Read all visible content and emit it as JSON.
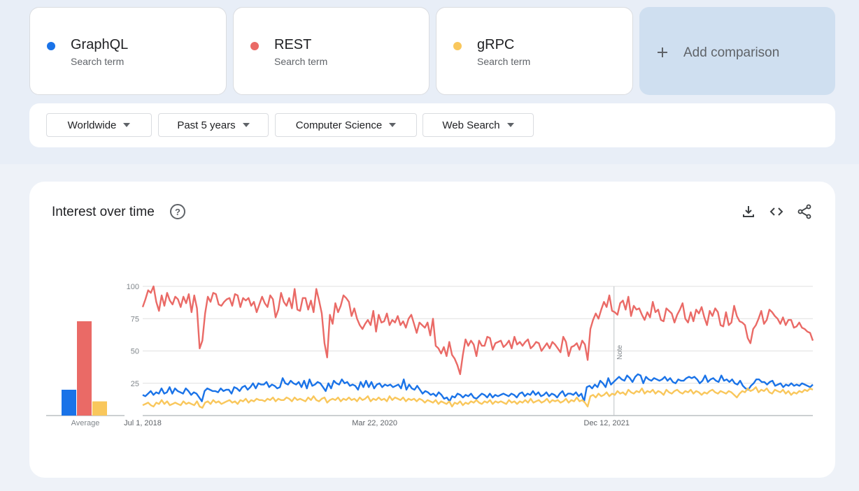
{
  "terms": [
    {
      "name": "GraphQL",
      "subtitle": "Search term",
      "color": "#1a73e8"
    },
    {
      "name": "REST",
      "subtitle": "Search term",
      "color": "#ea6a66"
    },
    {
      "name": "gRPC",
      "subtitle": "Search term",
      "color": "#f9c75c"
    }
  ],
  "add_comparison": {
    "label": "Add comparison",
    "icon": "plus-icon"
  },
  "filters": {
    "region": "Worldwide",
    "time": "Past 5 years",
    "category": "Computer Science",
    "source": "Web Search"
  },
  "chart_card": {
    "title": "Interest over time",
    "help_icon": "help-circle-icon",
    "actions": [
      "download-icon",
      "embed-code-icon",
      "share-icon"
    ]
  },
  "chart_data": [
    {
      "type": "bar",
      "categories": [
        "GraphQL",
        "REST",
        "gRPC"
      ],
      "values": [
        20,
        73,
        11
      ],
      "xlabel": "Average",
      "ylim": [
        0,
        100
      ],
      "colors": [
        "#1a73e8",
        "#ea6a66",
        "#f9c75c"
      ]
    },
    {
      "type": "line",
      "x_start": "2018-07-01",
      "x_end": "2023-06-25",
      "x_ticks": [
        "Jul 1, 2018",
        "Mar 22, 2020",
        "Dec 12, 2021"
      ],
      "y_ticks": [
        25,
        50,
        75,
        100
      ],
      "ylim": [
        0,
        100
      ],
      "grid": true,
      "annotation": {
        "label": "Note",
        "date": "2022-01-01"
      },
      "series": [
        {
          "name": "REST",
          "color": "#ea6a66",
          "values": [
            84,
            90,
            97,
            95,
            100,
            88,
            81,
            93,
            85,
            95,
            89,
            86,
            92,
            90,
            84,
            92,
            87,
            94,
            80,
            93,
            83,
            52,
            58,
            79,
            92,
            88,
            95,
            94,
            86,
            85,
            88,
            90,
            91,
            85,
            94,
            93,
            84,
            91,
            89,
            91,
            85,
            88,
            80,
            86,
            92,
            87,
            84,
            93,
            90,
            76,
            82,
            95,
            88,
            85,
            91,
            83,
            98,
            82,
            81,
            91,
            91,
            82,
            89,
            80,
            98,
            89,
            79,
            56,
            45,
            78,
            71,
            87,
            80,
            85,
            93,
            91,
            88,
            77,
            83,
            75,
            70,
            67,
            71,
            74,
            70,
            81,
            65,
            78,
            72,
            73,
            79,
            70,
            74,
            72,
            77,
            70,
            73,
            68,
            75,
            78,
            71,
            64,
            72,
            70,
            68,
            72,
            62,
            75,
            54,
            52,
            48,
            53,
            46,
            57,
            47,
            44,
            39,
            32,
            47,
            59,
            54,
            58,
            55,
            46,
            58,
            54,
            54,
            61,
            60,
            51,
            56,
            57,
            58,
            53,
            55,
            58,
            52,
            61,
            55,
            57,
            54,
            57,
            59,
            52,
            54,
            57,
            56,
            50,
            53,
            56,
            52,
            57,
            55,
            52,
            49,
            61,
            57,
            46,
            53,
            54,
            56,
            51,
            58,
            55,
            43,
            67,
            74,
            79,
            75,
            82,
            88,
            84,
            93,
            81,
            80,
            78,
            87,
            89,
            82,
            92,
            77,
            85,
            82,
            83,
            78,
            74,
            80,
            76,
            88,
            80,
            82,
            74,
            73,
            83,
            81,
            79,
            72,
            78,
            82,
            87,
            75,
            72,
            80,
            73,
            82,
            79,
            84,
            76,
            70,
            81,
            77,
            83,
            80,
            70,
            69,
            80,
            70,
            72,
            85,
            77,
            73,
            72,
            70,
            60,
            56,
            67,
            70,
            75,
            81,
            71,
            74,
            82,
            80,
            77,
            75,
            71,
            76,
            70,
            74,
            74,
            68,
            69,
            72,
            68,
            67,
            65,
            64,
            58
          ]
        },
        {
          "name": "GraphQL",
          "color": "#1a73e8",
          "values": [
            16,
            15,
            17,
            19,
            16,
            18,
            17,
            21,
            17,
            18,
            22,
            17,
            21,
            19,
            18,
            17,
            21,
            19,
            16,
            18,
            17,
            14,
            11,
            19,
            21,
            20,
            19,
            19,
            18,
            21,
            19,
            20,
            20,
            17,
            22,
            21,
            19,
            22,
            23,
            20,
            22,
            25,
            21,
            25,
            24,
            24,
            26,
            22,
            24,
            23,
            21,
            22,
            29,
            25,
            24,
            27,
            25,
            24,
            26,
            22,
            27,
            21,
            28,
            23,
            24,
            26,
            25,
            22,
            19,
            25,
            21,
            27,
            25,
            24,
            28,
            25,
            26,
            23,
            24,
            23,
            20,
            26,
            22,
            27,
            22,
            26,
            21,
            24,
            25,
            22,
            24,
            23,
            24,
            22,
            23,
            24,
            21,
            28,
            20,
            24,
            21,
            20,
            23,
            20,
            17,
            19,
            18,
            16,
            17,
            15,
            18,
            16,
            13,
            14,
            11,
            15,
            14,
            17,
            16,
            14,
            16,
            15,
            17,
            14,
            13,
            15,
            17,
            16,
            14,
            17,
            14,
            16,
            15,
            16,
            17,
            16,
            15,
            17,
            16,
            14,
            17,
            18,
            15,
            17,
            16,
            19,
            16,
            18,
            15,
            16,
            18,
            15,
            17,
            16,
            14,
            17,
            19,
            15,
            17,
            17,
            16,
            18,
            15,
            17,
            11,
            22,
            23,
            21,
            24,
            22,
            27,
            25,
            22,
            29,
            24,
            26,
            28,
            30,
            28,
            27,
            31,
            29,
            26,
            30,
            32,
            31,
            25,
            30,
            28,
            27,
            29,
            28,
            27,
            28,
            30,
            27,
            29,
            26,
            25,
            28,
            27,
            27,
            29,
            30,
            29,
            30,
            28,
            25,
            27,
            31,
            26,
            28,
            29,
            27,
            26,
            31,
            27,
            28,
            26,
            28,
            25,
            24,
            27,
            23,
            21,
            20,
            23,
            25,
            28,
            28,
            26,
            26,
            24,
            26,
            27,
            23,
            24,
            25,
            22,
            24,
            23,
            25,
            23,
            24,
            23,
            25,
            24,
            23,
            22,
            24
          ]
        },
        {
          "name": "gRPC",
          "color": "#f9c75c",
          "values": [
            8,
            9,
            10,
            8,
            7,
            10,
            9,
            12,
            9,
            11,
            8,
            9,
            10,
            9,
            8,
            11,
            9,
            10,
            9,
            8,
            11,
            7,
            6,
            10,
            11,
            9,
            12,
            10,
            11,
            9,
            10,
            11,
            12,
            10,
            11,
            9,
            12,
            11,
            13,
            10,
            12,
            11,
            13,
            12,
            12,
            11,
            13,
            12,
            14,
            11,
            13,
            12,
            12,
            14,
            13,
            11,
            14,
            12,
            13,
            12,
            11,
            14,
            12,
            15,
            12,
            11,
            13,
            14,
            10,
            12,
            13,
            12,
            14,
            11,
            13,
            12,
            14,
            12,
            13,
            11,
            14,
            12,
            13,
            15,
            11,
            13,
            12,
            14,
            12,
            13,
            11,
            15,
            12,
            14,
            13,
            12,
            14,
            11,
            13,
            12,
            13,
            11,
            13,
            12,
            10,
            12,
            11,
            10,
            12,
            9,
            11,
            10,
            9,
            11,
            7,
            10,
            9,
            11,
            8,
            10,
            9,
            11,
            10,
            12,
            10,
            9,
            11,
            10,
            12,
            9,
            11,
            10,
            11,
            10,
            9,
            12,
            10,
            11,
            9,
            11,
            10,
            12,
            10,
            13,
            10,
            11,
            12,
            10,
            11,
            13,
            10,
            12,
            11,
            12,
            10,
            11,
            13,
            10,
            12,
            11,
            14,
            11,
            12,
            10,
            7,
            15,
            16,
            14,
            17,
            15,
            16,
            18,
            15,
            17,
            16,
            19,
            17,
            18,
            16,
            20,
            18,
            17,
            19,
            18,
            21,
            17,
            19,
            18,
            20,
            17,
            19,
            18,
            16,
            20,
            18,
            17,
            19,
            20,
            18,
            17,
            19,
            18,
            20,
            17,
            19,
            18,
            16,
            18,
            17,
            19,
            20,
            18,
            17,
            19,
            18,
            17,
            19,
            18,
            16,
            14,
            17,
            19,
            18,
            21,
            19,
            20,
            22,
            18,
            20,
            19,
            21,
            18,
            17,
            20,
            19,
            18,
            20,
            17,
            19,
            16,
            18,
            17,
            19,
            18,
            20,
            19,
            21,
            20
          ]
        }
      ]
    }
  ]
}
